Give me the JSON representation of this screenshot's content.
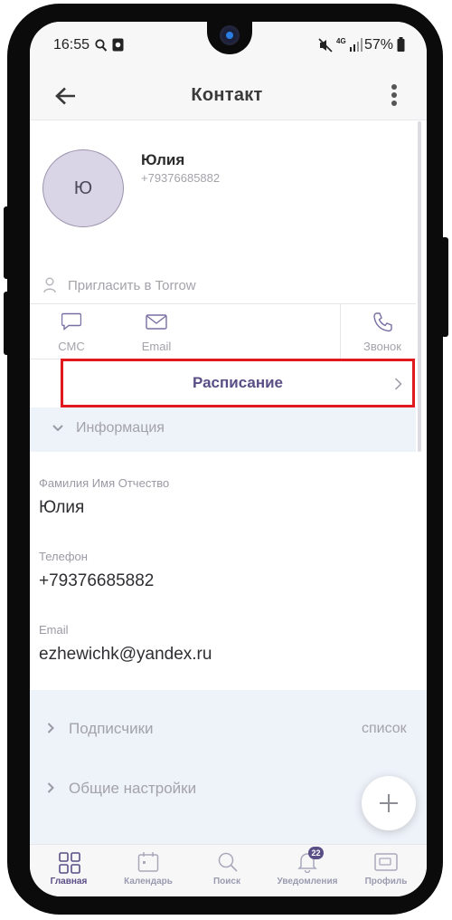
{
  "status_bar": {
    "time": "16:55",
    "network": "4G",
    "battery": "57%"
  },
  "header": {
    "title": "Контакт"
  },
  "contact": {
    "avatar_initial": "Ю",
    "name": "Юлия",
    "phone": "+79376685882"
  },
  "invite": {
    "label": "Пригласить в Torrow"
  },
  "actions": [
    {
      "label": "СМС",
      "icon": "sms-icon"
    },
    {
      "label": "Email",
      "icon": "mail-icon"
    },
    {
      "label": "Звонок",
      "icon": "phone-icon"
    }
  ],
  "schedule": {
    "label": "Расписание",
    "highlight_color": "#e0191f"
  },
  "info_section": {
    "title": "Информация"
  },
  "fields": [
    {
      "label": "Фамилия Имя Отчество",
      "value": "Юлия"
    },
    {
      "label": "Телефон",
      "value": "+79376685882"
    },
    {
      "label": "Email",
      "value": "ezhewichk@yandex.ru"
    }
  ],
  "subscribers": {
    "label": "Подписчики",
    "value": "список"
  },
  "settings": {
    "label": "Общие настройки"
  },
  "nav": [
    {
      "label": "Главная",
      "icon": "grid-icon",
      "active": true
    },
    {
      "label": "Календарь",
      "icon": "calendar-icon"
    },
    {
      "label": "Поиск",
      "icon": "search-icon"
    },
    {
      "label": "Уведомления",
      "icon": "bell-icon",
      "badge": "22"
    },
    {
      "label": "Профиль",
      "icon": "profile-card-icon"
    }
  ],
  "colors": {
    "accent": "#5a4e86",
    "muted": "#a3a3aa",
    "band": "#eef2f9"
  }
}
